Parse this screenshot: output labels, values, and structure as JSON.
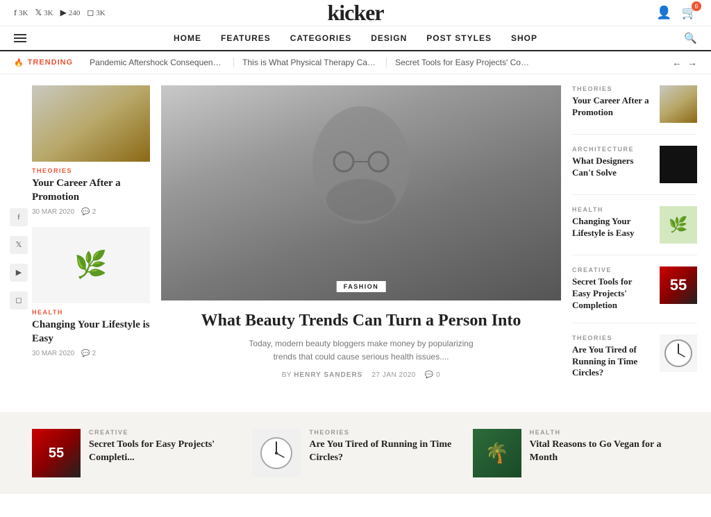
{
  "site": {
    "logo": "kicker"
  },
  "topbar": {
    "social": [
      {
        "icon": "f",
        "label": "3K",
        "platform": "facebook"
      },
      {
        "icon": "🐦",
        "label": "3K",
        "platform": "twitter"
      },
      {
        "icon": "▶",
        "label": "240",
        "platform": "youtube"
      },
      {
        "icon": "📷",
        "label": "3K",
        "platform": "instagram"
      }
    ],
    "cart_count": "6"
  },
  "nav": {
    "items": [
      {
        "label": "HOME",
        "active": true
      },
      {
        "label": "FEATURES",
        "active": false
      },
      {
        "label": "CATEGORIES",
        "active": false
      },
      {
        "label": "DESIGN",
        "active": false
      },
      {
        "label": "POST STYLES",
        "active": false
      },
      {
        "label": "SHOP",
        "active": false
      }
    ]
  },
  "trending": {
    "label": "TRENDING",
    "items": [
      "Pandemic Aftershock Consequences",
      "This is What Physical Therapy Can Ac...",
      "Secret Tools for Easy Projects' Compl ..."
    ]
  },
  "social_sidebar": [
    {
      "icon": "f",
      "platform": "facebook"
    },
    {
      "icon": "🐦",
      "platform": "twitter"
    },
    {
      "icon": "▶",
      "platform": "youtube"
    },
    {
      "icon": "📷",
      "platform": "instagram"
    }
  ],
  "left_cards": [
    {
      "category": "THEORIES",
      "title": "Your Career After a Promotion",
      "date": "30 MAR 2020",
      "comments": "2",
      "img_type": "arch"
    },
    {
      "category": "HEALTH",
      "title": "Changing Your Lifestyle is Easy",
      "date": "30 MAR 2020",
      "comments": "2",
      "img_type": "plant"
    }
  ],
  "featured": {
    "tag": "FASHION",
    "title": "What Beauty Trends Can Turn a Person Into",
    "excerpt": "Today, modern beauty bloggers make money by popularizing trends that could cause serious health issues....",
    "author": "HENRY SANDERS",
    "date": "27 JAN 2020",
    "comments": "0"
  },
  "right_cards": [
    {
      "category": "THEORIES",
      "title": "Your Career After a Promotion",
      "img_type": "arch"
    },
    {
      "category": "ARCHITECTURE",
      "title": "What Designers Can't Solve",
      "img_type": "dark"
    },
    {
      "category": "HEALTH",
      "title": "Changing Your Lifestyle is Easy",
      "img_type": "plant"
    },
    {
      "category": "CREATIVE",
      "title": "Secret Tools for Easy Projects' Completion",
      "img_type": "creative"
    },
    {
      "category": "THEORIES",
      "title": "Are You Tired of Running in Time Circles?",
      "img_type": "clock"
    }
  ],
  "bottom_cards": [
    {
      "category": "CREATIVE",
      "title": "Secret Tools for Easy Projects' Completi...",
      "img_type": "creative"
    },
    {
      "category": "THEORIES",
      "title": "Are You Tired of Running in Time Circles?",
      "img_type": "clock"
    },
    {
      "category": "HEALTH",
      "title": "Vital Reasons to Go Vegan for a Month",
      "img_type": "tropical"
    }
  ]
}
